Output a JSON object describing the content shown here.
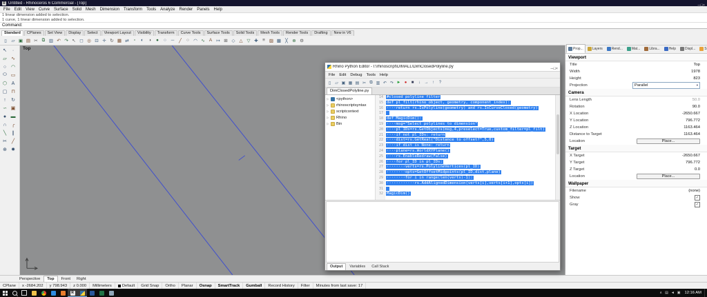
{
  "titlebar": {
    "title": "Untitled - Rhinoceros 6 Commercial - [Top]",
    "app_icon": "rhino-logo"
  },
  "window_buttons": [
    "minimize",
    "maximize",
    "close"
  ],
  "menubar": [
    "File",
    "Edit",
    "View",
    "Curve",
    "Surface",
    "Solid",
    "Mesh",
    "Dimension",
    "Transform",
    "Tools",
    "Analyze",
    "Render",
    "Panels",
    "Help"
  ],
  "command": {
    "history": [
      "1 linear dimension added to selection.",
      "1 curve, 1 linear dimension added to selection."
    ],
    "prompt": "Command:"
  },
  "toolbar_tabs": {
    "tabs": [
      "Standard",
      "CPlanes",
      "Set View",
      "Display",
      "Select",
      "Viewport Layout",
      "Visibility",
      "Transform",
      "Curve Tools",
      "Surface Tools",
      "Solid Tools",
      "Mesh Tools",
      "Render Tools",
      "Drafting",
      "New in V6"
    ],
    "active": "Standard"
  },
  "top_icons": [
    "new-file",
    "open-file",
    "save",
    "print",
    "cut",
    "copy",
    "paste",
    "undo",
    "redo",
    "select",
    "select-window",
    "zoom-extents",
    "zoom-window",
    "pan",
    "rotate-view",
    "named-views",
    "move",
    "copy-object",
    "rotate",
    "scale",
    "mirror",
    "array",
    "trim",
    "split",
    "join",
    "group",
    "layer-tools",
    "object-properties",
    "hide",
    "show",
    "lock",
    "point",
    "line",
    "polyline",
    "circle",
    "arc",
    "curve",
    "text",
    "dimension",
    "options"
  ],
  "left_icons": [
    "select",
    "point",
    "polyline",
    "curve",
    "circle",
    "arc",
    "ellipse",
    "rectangle",
    "polygon",
    "text",
    "surface",
    "loft",
    "extrude",
    "revolve",
    "sweep",
    "box",
    "sphere",
    "cylinder",
    "boolean",
    "fillet",
    "chamfer",
    "offset",
    "trim",
    "split",
    "join",
    "explode"
  ],
  "viewport": {
    "label": "Top"
  },
  "editor": {
    "title": "Rhino Python Editor - I:\\rhinoscript\\DIMALL\\DimClosedPolyline.py",
    "menus": [
      "File",
      "Edit",
      "Debug",
      "Tools",
      "Help"
    ],
    "toolbar_icons": [
      "new-file",
      "open-file",
      "save",
      "save-all",
      "print",
      "cut",
      "copy",
      "paste",
      "undo",
      "redo",
      "run",
      "debug",
      "stop",
      "step-into",
      "step-over",
      "step-out",
      "help"
    ],
    "tab": "DimClosedPolyline.py",
    "tree": [
      {
        "label": "<python>",
        "icon": "python"
      },
      {
        "label": "rhinoscriptsyntax",
        "icon": "module"
      },
      {
        "label": "scriptcontext",
        "icon": "module"
      },
      {
        "label": "Rhino",
        "icon": "module"
      },
      {
        "label": "Bin",
        "icon": "folder"
      }
    ],
    "code": [
      {
        "n": 14,
        "t": "#closed polyline filter"
      },
      {
        "n": 15,
        "t": "def pl_filt(rhino_object, geometry, component_index):"
      },
      {
        "n": 16,
        "t": "····return rs.IsPolyline(geometry) and rs.IsCurveClosed(geometry)"
      },
      {
        "n": 17,
        "t": ""
      },
      {
        "n": 18,
        "t": "def MagicDim():"
      },
      {
        "n": 19,
        "t": "····msg=\"Select polylines to dimension\""
      },
      {
        "n": 20,
        "t": "····pl_IDs=rs.GetObjects(msg,4,preselect=True,custom_filter=pl_filt)"
      },
      {
        "n": 21,
        "t": "····if not pl_IDs: return"
      },
      {
        "n": 22,
        "t": "····dist=rs.GetReal(\"Distance to offset?\",5,0)"
      },
      {
        "n": 23,
        "t": "····if dist is None: return"
      },
      {
        "n": 24,
        "t": "····plane=rs.WorldXYPlane()"
      },
      {
        "n": 25,
        "t": "····rs.EnableRedraw(False)"
      },
      {
        "n": 26,
        "t": "····for pl_ID in pl_IDs:"
      },
      {
        "n": 27,
        "t": "········verts=rs.PolylineVertices(pl_ID)"
      },
      {
        "n": 28,
        "t": "········opts=GetOffsetMidpoints(pl_ID,dist,plane)"
      },
      {
        "n": 29,
        "t": "········for i in range(len(verts)-1):"
      },
      {
        "n": 30,
        "t": "············rs.AddAlignedDimension(verts[i],verts[i+1],opts[i])"
      },
      {
        "n": 31,
        "t": ""
      },
      {
        "n": 32,
        "t": "MagicDim()"
      }
    ],
    "bottom_tabs": [
      "Output",
      "Variables",
      "Call Stack"
    ],
    "active_bottom_tab": "Output"
  },
  "panel": {
    "tabs": [
      {
        "label": "Prop...",
        "icon": "properties"
      },
      {
        "label": "Layers",
        "icon": "layers"
      },
      {
        "label": "Rend...",
        "icon": "render"
      },
      {
        "label": "Mat...",
        "icon": "materials"
      },
      {
        "label": "Libra...",
        "icon": "libraries"
      },
      {
        "label": "Help",
        "icon": "help"
      },
      {
        "label": "Displ...",
        "icon": "display"
      },
      {
        "label": "Sun",
        "icon": "sun"
      }
    ],
    "active_tab": "Prop...",
    "sections": [
      {
        "title": "Viewport",
        "rows": [
          {
            "label": "Title",
            "value": "Top"
          },
          {
            "label": "Width",
            "value": "1978"
          },
          {
            "label": "Height",
            "value": "823"
          },
          {
            "label": "Projection",
            "value": "Parallel",
            "type": "select"
          }
        ]
      },
      {
        "title": "Camera",
        "rows": [
          {
            "label": "Lens Length",
            "value": "50.0",
            "muted": true
          },
          {
            "label": "Rotation",
            "value": "90.0"
          },
          {
            "label": "X Location",
            "value": "-2650.667"
          },
          {
            "label": "Y Location",
            "value": "796.772"
          },
          {
            "label": "Z Location",
            "value": "1163.464"
          },
          {
            "label": "Distance to Target",
            "value": "1163.464"
          },
          {
            "label": "Location",
            "value": "Place...",
            "type": "button"
          }
        ]
      },
      {
        "title": "Target",
        "rows": [
          {
            "label": "X Target",
            "value": "-2650.667"
          },
          {
            "label": "Y Target",
            "value": "796.772"
          },
          {
            "label": "Z Target",
            "value": "0.0"
          },
          {
            "label": "Location",
            "value": "Place...",
            "type": "button"
          }
        ]
      },
      {
        "title": "Wallpaper",
        "rows": [
          {
            "label": "Filename",
            "value": "(none)"
          },
          {
            "label": "Show",
            "type": "checkbox",
            "checked": true
          },
          {
            "label": "Gray",
            "type": "checkbox",
            "checked": true
          }
        ]
      }
    ]
  },
  "viewport_tabs": {
    "tabs": [
      "Perspective",
      "Top",
      "Front",
      "Right"
    ],
    "active": "Top"
  },
  "statusbar": {
    "cplane": "CPlane",
    "x": "x -2684.202",
    "y": "y 798.943",
    "z": "z 0.000",
    "units": "Millimeters",
    "layer": "Default",
    "toggles": [
      {
        "label": "Grid Snap",
        "active": false
      },
      {
        "label": "Ortho",
        "active": false
      },
      {
        "label": "Planar",
        "active": false
      },
      {
        "label": "Osnap",
        "active": true
      },
      {
        "label": "SmartTrack",
        "active": true
      },
      {
        "label": "Gumball",
        "active": true
      },
      {
        "label": "Record History",
        "active": false
      },
      {
        "label": "Filter",
        "active": false
      },
      {
        "label": "Minutes from last save: 17",
        "active": false
      }
    ]
  },
  "taskbar": {
    "icons": [
      {
        "name": "search",
        "active": false
      },
      {
        "name": "task-view",
        "active": false
      },
      {
        "name": "file-explorer",
        "active": false
      },
      {
        "name": "chrome",
        "active": false
      },
      {
        "name": "edge",
        "active": false
      },
      {
        "name": "media-player",
        "active": false
      },
      {
        "name": "rhino",
        "active": true
      },
      {
        "name": "python-editor",
        "active": true
      },
      {
        "name": "word",
        "active": false
      },
      {
        "name": "excel",
        "active": false
      },
      {
        "name": "notepad",
        "active": false
      }
    ],
    "tray_icons": [
      "tray-expand",
      "tray-network",
      "tray-volume",
      "tray-notifications"
    ],
    "time": "12:16 AM"
  }
}
